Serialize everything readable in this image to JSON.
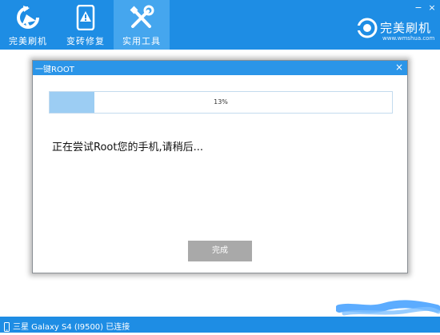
{
  "nav": {
    "tabs": [
      {
        "label": "完美刷机",
        "icon": "refresh-icon"
      },
      {
        "label": "变砖修复",
        "icon": "warning-phone-icon"
      },
      {
        "label": "实用工具",
        "icon": "tools-icon",
        "active": true
      }
    ]
  },
  "window_controls": {
    "minimize": "−",
    "close": "×"
  },
  "brand": {
    "name": "完美刷机",
    "url": "www.wmshua.com"
  },
  "dialog": {
    "title": "一键ROOT",
    "close": "×",
    "progress": {
      "value": 0.13,
      "label": "13%"
    },
    "message": "正在尝试Root您的手机,请稍后...",
    "done_button": "完成"
  },
  "statusbar": {
    "device": "三星 Galaxy S4 (I9500) 已连接",
    "icon": "phone-icon"
  },
  "colors": {
    "primary": "#1e8de4",
    "active_tab": "#45a6ee",
    "progress_fill": "#9ccdf3",
    "button_disabled": "#a9a9a9"
  }
}
